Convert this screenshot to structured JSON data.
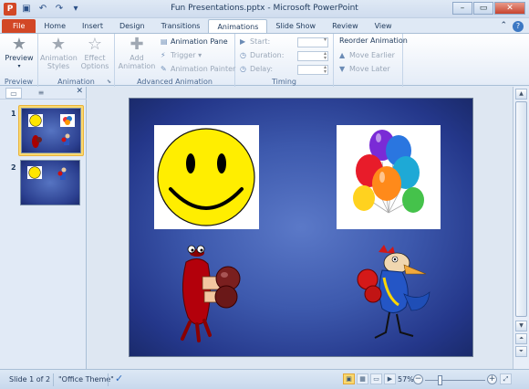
{
  "window": {
    "title": "Fun Presentations.pptx - Microsoft PowerPoint",
    "app_icon_letter": "P",
    "controls": [
      "–",
      "▭",
      "✕"
    ]
  },
  "quick_access": {
    "icons": [
      "save-icon",
      "undo-icon",
      "redo-icon",
      "customize-icon"
    ]
  },
  "tabs": [
    {
      "label": "File",
      "kind": "file"
    },
    {
      "label": "Home"
    },
    {
      "label": "Insert"
    },
    {
      "label": "Design"
    },
    {
      "label": "Transitions"
    },
    {
      "label": "Animations",
      "active": true
    },
    {
      "label": "Slide Show"
    },
    {
      "label": "Review"
    },
    {
      "label": "View"
    }
  ],
  "ribbon": {
    "preview": {
      "button": "Preview",
      "group": "Preview"
    },
    "animation": {
      "styles_l1": "Animation",
      "styles_l2": "Styles",
      "options_l1": "Effect",
      "options_l2": "Options",
      "group": "Animation"
    },
    "advanced": {
      "add_l1": "Add",
      "add_l2": "Animation",
      "pane": "Animation Pane",
      "trigger": "Trigger",
      "painter": "Animation Painter",
      "group": "Advanced Animation"
    },
    "timing": {
      "start_label": "Start:",
      "duration_label": "Duration:",
      "delay_label": "Delay:",
      "group": "Timing"
    },
    "reorder": {
      "title": "Reorder Animation",
      "earlier": "Move Earlier",
      "later": "Move Later"
    }
  },
  "slides_pane": {
    "close": "✕",
    "slides": [
      {
        "number": "1",
        "selected": true
      },
      {
        "number": "2"
      }
    ]
  },
  "status": {
    "slide_info": "Slide 1 of 2",
    "theme": "\"Office Theme\"",
    "zoom": "57%",
    "zoom_level": 0.57
  },
  "colors": {
    "file_tab": "#d24726",
    "slide_bg": "#3d59ad",
    "selection": "#fbd96e"
  }
}
